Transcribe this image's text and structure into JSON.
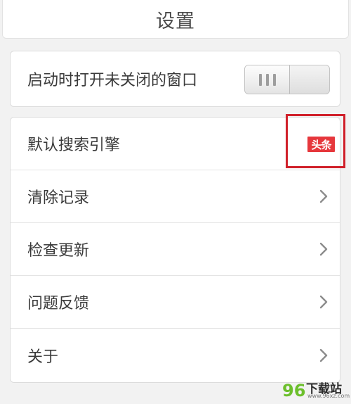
{
  "header": {
    "title": "设置"
  },
  "restore_windows": {
    "label": "启动时打开未关闭的窗口",
    "toggle_on": false
  },
  "settings": {
    "search_engine": {
      "label": "默认搜索引擎",
      "badge": "头条"
    },
    "items": [
      {
        "label": "清除记录",
        "icon": "chevron-right-icon"
      },
      {
        "label": "检查更新",
        "icon": "chevron-right-icon"
      },
      {
        "label": "问题反馈",
        "icon": "chevron-right-icon"
      },
      {
        "label": "关于",
        "icon": "chevron-right-icon"
      }
    ]
  },
  "watermark": {
    "logo_text": "96",
    "text": "下载站",
    "url": "www.96xz.com"
  },
  "colors": {
    "accent_red": "#d0202a",
    "badge_red": "#e6373c",
    "background": "#f2f2f2",
    "card": "#ffffff",
    "watermark_green": "#6cbf2c"
  }
}
